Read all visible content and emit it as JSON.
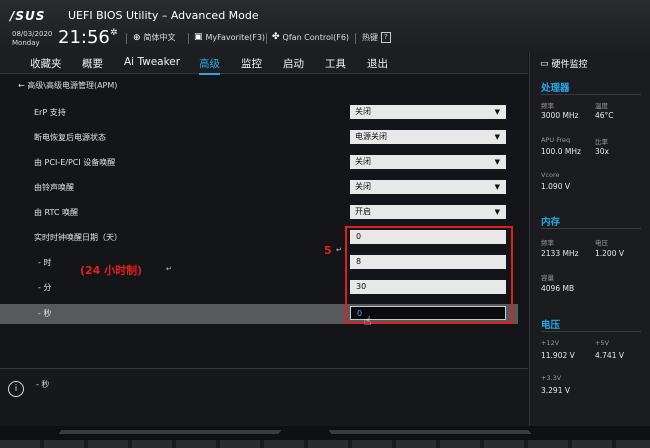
{
  "header": {
    "logo": "/SUS",
    "title": "UEFI BIOS Utility – Advanced Mode",
    "date": "08/03/2020",
    "weekday": "Monday",
    "time": "21:56",
    "language": "简体中文",
    "myfavorite": "MyFavorite(F3)",
    "qfan": "Qfan Control(F6)",
    "hotkey_label": "热键",
    "hotkey_key": "?"
  },
  "nav": {
    "tabs": [
      "收藏夹",
      "概要",
      "Ai Tweaker",
      "高级",
      "监控",
      "启动",
      "工具",
      "退出"
    ],
    "active": "高级"
  },
  "main": {
    "breadcrumb": "高级\\高级电源管理(APM)",
    "settings": [
      {
        "label": "ErP 支持",
        "value": "关闭",
        "kind": "select"
      },
      {
        "label": "断电恢复后电源状态",
        "value": "电源关闭",
        "kind": "select"
      },
      {
        "label": "由 PCI-E/PCI 设备唤醒",
        "value": "关闭",
        "kind": "select"
      },
      {
        "label": "由铃声唤醒",
        "value": "关闭",
        "kind": "select"
      },
      {
        "label": "由 RTC 唤醒",
        "value": "开启",
        "kind": "select"
      },
      {
        "label": "实时时钟唤醒日期（天）",
        "value": "0",
        "kind": "input"
      },
      {
        "label": "- 时",
        "value": "8",
        "kind": "input"
      },
      {
        "label": "- 分",
        "value": "30",
        "kind": "input"
      },
      {
        "label": "- 秒",
        "value": "0",
        "kind": "input"
      }
    ]
  },
  "annotations": {
    "step": "5",
    "return_mark": "↵",
    "note": "(24 小时制)"
  },
  "info": {
    "text": "- 秒"
  },
  "hw_monitor": {
    "title": "硬件监控",
    "cpu": {
      "heading": "处理器",
      "freq_label": "频率",
      "freq_value": "3000 MHz",
      "temp_label": "温度",
      "temp_value": "46°C",
      "apu_label": "APU Freq",
      "apu_value": "100.0 MHz",
      "ratio_label": "比率",
      "ratio_value": "30x",
      "vcore_label": "Vcore",
      "vcore_value": "1.090 V"
    },
    "memory": {
      "heading": "内存",
      "freq_label": "频率",
      "freq_value": "2133 MHz",
      "volt_label": "电压",
      "volt_value": "1.200 V",
      "cap_label": "容量",
      "cap_value": "4096 MB"
    },
    "voltage": {
      "heading": "电压",
      "v12_label": "+12V",
      "v12_value": "11.902 V",
      "v5_label": "+5V",
      "v5_value": "4.741 V",
      "v33_label": "+3.3V",
      "v33_value": "3.291 V"
    }
  },
  "colors": {
    "accent": "#2aa7e6",
    "annotation": "#e02020",
    "highlight_row": "#58595c"
  }
}
